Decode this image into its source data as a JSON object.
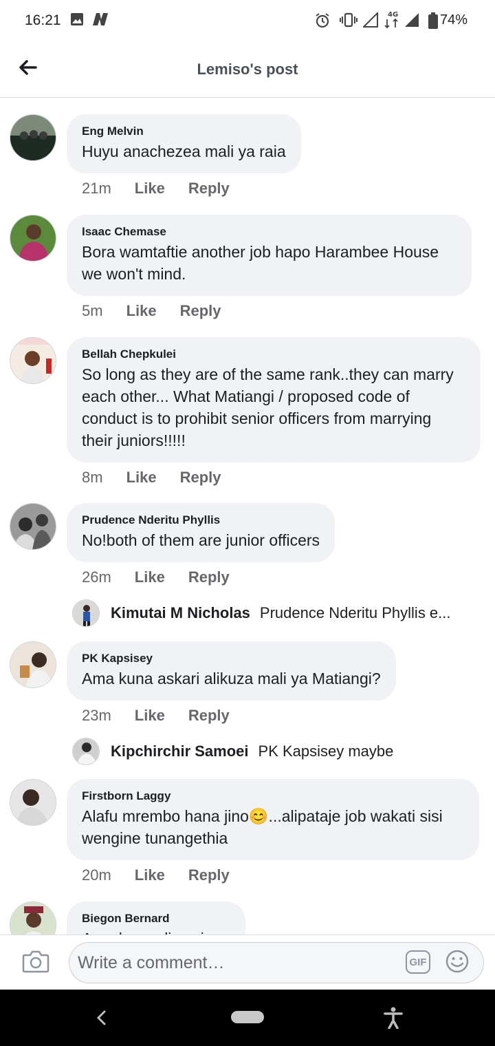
{
  "status_bar": {
    "time": "16:21",
    "battery": "74%",
    "network": "4G",
    "icons": [
      "image-icon",
      "n-icon",
      "alarm-icon",
      "vibrate-icon",
      "signal-icon",
      "4g-data-icon",
      "battery-icon"
    ]
  },
  "header": {
    "title": "Lemiso's post",
    "back_icon": "back-arrow-icon"
  },
  "comments": [
    {
      "author": "Eng Melvin",
      "text": "Huyu anachezea mali ya raia",
      "time": "21m",
      "like": "Like",
      "reply": "Reply",
      "avatar_colors": [
        "#46513f",
        "#1e2b22"
      ]
    },
    {
      "author": "Isaac Chemase",
      "text": "Bora wamtaftie another job hapo Harambee House we won't mind.",
      "time": "5m",
      "like": "Like",
      "reply": "Reply",
      "avatar_colors": [
        "#5b8a3c",
        "#b8326a"
      ]
    },
    {
      "author": "Bellah Chepkulei",
      "text": "So long as they are of the same rank..they can marry each other... What Matiangi / proposed code of conduct is to prohibit senior officers from marrying their juniors!!!!!",
      "time": "8m",
      "like": "Like",
      "reply": "Reply",
      "avatar_colors": [
        "#f1e4d4",
        "#6a3e27"
      ]
    },
    {
      "author": "Prudence Nderitu Phyllis",
      "text": "No!both of them are junior officers",
      "time": "26m",
      "like": "Like",
      "reply": "Reply",
      "avatar_colors": [
        "#8a8a8a",
        "#2c2c2c"
      ],
      "reply_preview": {
        "author": "Kimutai M Nicholas",
        "text": "Prudence Nderitu Phyllis e...",
        "avatar_colors": [
          "#d9d9d9",
          "#2a56a8"
        ]
      }
    },
    {
      "author": "PK Kapsisey",
      "text": "Ama kuna askari alikuza mali ya Matiangi?",
      "time": "23m",
      "like": "Like",
      "reply": "Reply",
      "avatar_colors": [
        "#e8e0d6",
        "#3b2b23"
      ],
      "reply_preview": {
        "author": "Kipchirchir Samoei",
        "text": "PK Kapsisey maybe",
        "avatar_colors": [
          "#cfcfcf",
          "#2b2b2b"
        ]
      }
    },
    {
      "author": "Firstborn Laggy",
      "text": "Alafu mrembo hana jino😊...alipataje job wakati sisi wengine tunangethia",
      "time": "20m",
      "like": "Like",
      "reply": "Reply",
      "avatar_colors": [
        "#e6e6e6",
        "#3a2a22"
      ]
    },
    {
      "author": "Biegon Bernard",
      "text": "Angalau waliowai...",
      "avatar_colors": [
        "#d8e2cc",
        "#8b2a3a"
      ]
    }
  ],
  "composer": {
    "placeholder": "Write a comment…",
    "gif_label": "GIF",
    "camera_icon": "camera-icon",
    "emoji_icon": "emoji-icon"
  },
  "navbar": {
    "icons": [
      "nav-back-icon",
      "home-pill",
      "accessibility-icon"
    ]
  }
}
